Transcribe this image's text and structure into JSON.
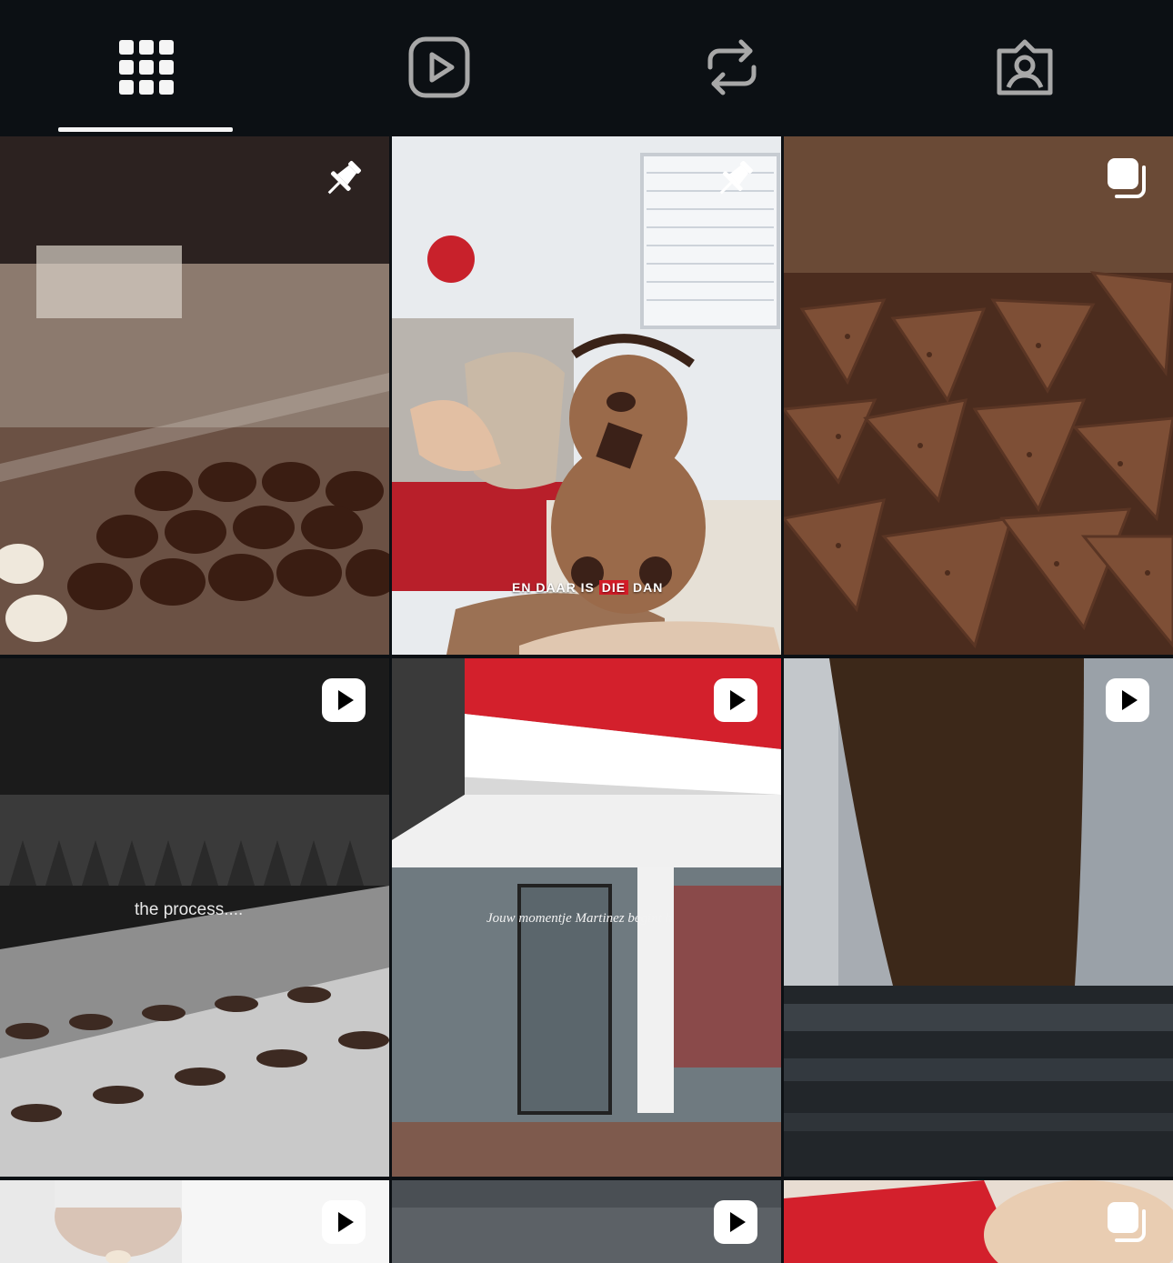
{
  "tabs": [
    {
      "id": "posts",
      "icon": "grid-icon",
      "selected": true
    },
    {
      "id": "reels",
      "icon": "reels-play-icon",
      "selected": false
    },
    {
      "id": "reposts",
      "icon": "repost-icon",
      "selected": false
    },
    {
      "id": "tagged",
      "icon": "tagged-user-icon",
      "selected": false
    }
  ],
  "posts": [
    {
      "subject": "pralines in display case",
      "badge": "pin-icon",
      "caption": ""
    },
    {
      "subject": "chocolate teddy bear",
      "badge": "pin-icon",
      "caption_parts": [
        "EN DAAR IS ",
        "DIE",
        " DAN"
      ]
    },
    {
      "subject": "chocolate triangles with sprinkles",
      "badge": "carousel-icon",
      "caption": ""
    },
    {
      "subject": "chocolate production line",
      "badge": "reel-icon",
      "caption": "the process...."
    },
    {
      "subject": "shop storefront",
      "badge": "reel-icon",
      "caption": "Jouw momentje Martinez begint h"
    },
    {
      "subject": "chocolate pouring machine",
      "badge": "reel-icon",
      "caption": ""
    },
    {
      "subject": "chocolatier at work",
      "badge": "reel-icon",
      "caption": ""
    },
    {
      "subject": "workshop interior",
      "badge": "reel-icon",
      "caption": ""
    },
    {
      "subject": "branded chocolate box",
      "badge": "carousel-icon",
      "caption": ""
    }
  ],
  "colors": {
    "background": "#0c1014",
    "icon": "#a8a8a8",
    "icon_active": "#f5f5f5",
    "brand_red": "#d41c27"
  }
}
